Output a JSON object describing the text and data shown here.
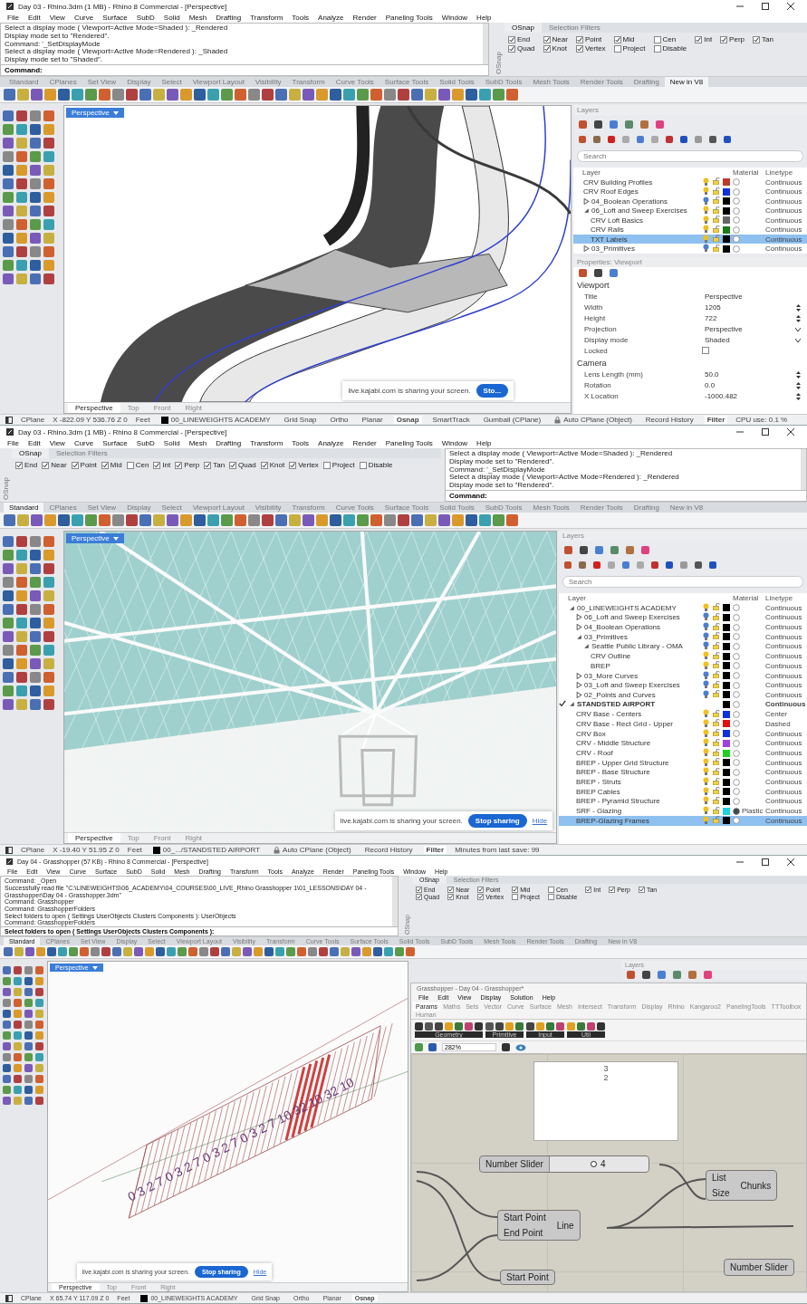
{
  "windows": [
    {
      "title": "Day 03 - Rhino.3dm (1 MB) - Rhino 8 Commercial - [Perspective]",
      "menu": [
        "File",
        "Edit",
        "View",
        "Curve",
        "Surface",
        "SubD",
        "Solid",
        "Mesh",
        "Drafting",
        "Transform",
        "Tools",
        "Analyze",
        "Render",
        "Paneling Tools",
        "Window",
        "Help"
      ],
      "command": {
        "lines": [
          "Select a display mode ( Viewport=Active  Mode=Shaded ): _Rendered",
          "Display mode set to \"Rendered\".",
          "Command: '_SetDisplayMode",
          "Select a display mode ( Viewport=Active  Mode=Rendered ): _Shaded",
          "Display mode set to \"Shaded\"."
        ],
        "prompt": "Command:"
      },
      "osnap": {
        "side_label": "OSnap",
        "tabs": [
          {
            "label": "OSnap",
            "selected": true
          },
          {
            "label": "Selection Filters",
            "selected": false
          }
        ],
        "options": [
          {
            "label": "End",
            "checked": true
          },
          {
            "label": "Near",
            "checked": true
          },
          {
            "label": "Point",
            "checked": true
          },
          {
            "label": "Mid",
            "checked": true
          },
          {
            "label": "Cen",
            "checked": false
          },
          {
            "label": "Int",
            "checked": true
          },
          {
            "label": "Perp",
            "checked": true
          },
          {
            "label": "Tan",
            "checked": true
          },
          {
            "label": "Quad",
            "checked": true
          },
          {
            "label": "Knot",
            "checked": true
          },
          {
            "label": "Vertex",
            "checked": true
          },
          {
            "label": "Project",
            "checked": false
          },
          {
            "label": "Disable",
            "checked": false
          }
        ]
      },
      "toolbar_tabs": [
        {
          "label": "Standard",
          "selected": false
        },
        {
          "label": "CPlanes",
          "selected": false
        },
        {
          "label": "Set View",
          "selected": false
        },
        {
          "label": "Display",
          "selected": false
        },
        {
          "label": "Select",
          "selected": false
        },
        {
          "label": "Viewport Layout",
          "selected": false
        },
        {
          "label": "Visibility",
          "selected": false
        },
        {
          "label": "Transform",
          "selected": false
        },
        {
          "label": "Curve Tools",
          "selected": false
        },
        {
          "label": "Surface Tools",
          "selected": false
        },
        {
          "label": "Solid Tools",
          "selected": false
        },
        {
          "label": "SubD Tools",
          "selected": false
        },
        {
          "label": "Mesh Tools",
          "selected": false
        },
        {
          "label": "Render Tools",
          "selected": false
        },
        {
          "label": "Drafting",
          "selected": false
        },
        {
          "label": "New in V8",
          "selected": true
        }
      ],
      "viewport": {
        "label": "Perspective",
        "tabs": [
          {
            "label": "Perspective",
            "selected": true
          },
          {
            "label": "Top",
            "selected": false
          },
          {
            "label": "Front",
            "selected": false
          },
          {
            "label": "Right",
            "selected": false
          }
        ]
      },
      "sharing": {
        "text": "live.kajabi.com is sharing your screen.",
        "button": "Sto..."
      },
      "panel": {
        "kind": "layers-properties",
        "layers": {
          "title": "Layers",
          "placeholder": "Search",
          "columns": [
            "Layer",
            "Material",
            "Linetype"
          ],
          "rows": [
            {
              "name": "CRV Building Profiles",
              "lit": true,
              "color": "#c0392b",
              "linetype": "Continuous",
              "selected": false
            },
            {
              "name": "CRV Roof Edges",
              "lit": true,
              "color": "#1030e0",
              "linetype": "Continuous",
              "selected": false
            },
            {
              "name": "04_Boolean Operations",
              "lit": false,
              "color": "#000000",
              "linetype": "Continuous",
              "selected": false,
              "expanded": false
            },
            {
              "name": "06_Loft and Sweep Exercises",
              "lit": true,
              "color": "#000000",
              "linetype": "Continuous",
              "selected": false,
              "expanded": true,
              "children": [
                {
                  "name": "CRV Loft Basics",
                  "lit": true,
                  "color": "#666666",
                  "linetype": "Continuous",
                  "selected": false
                },
                {
                  "name": "CRV Rails",
                  "lit": true,
                  "color": "#1a7a1a",
                  "linetype": "Continuous",
                  "selected": false
                },
                {
                  "name": "TXT Labels",
                  "lit": true,
                  "color": "#000000",
                  "linetype": "Continuous",
                  "selected": true
                }
              ]
            },
            {
              "name": "03_Primitives",
              "lit": false,
              "color": "#000000",
              "linetype": "Continuous",
              "selected": false,
              "expanded": false
            }
          ]
        },
        "properties": {
          "title": "Properties: Viewport",
          "sections": [
            {
              "title": "Viewport",
              "fields": [
                {
                  "label": "Title",
                  "kind": "text",
                  "value": "Perspective"
                },
                {
                  "label": "Width",
                  "kind": "spin",
                  "value": "1205"
                },
                {
                  "label": "Height",
                  "kind": "spin",
                  "value": "722"
                },
                {
                  "label": "Projection",
                  "kind": "select",
                  "value": "Perspective"
                },
                {
                  "label": "Display mode",
                  "kind": "select",
                  "value": "Shaded"
                },
                {
                  "label": "Locked",
                  "kind": "checkbox",
                  "checked": false
                }
              ]
            },
            {
              "title": "Camera",
              "fields": [
                {
                  "label": "Lens Length (mm)",
                  "kind": "spin",
                  "value": "50.0"
                },
                {
                  "label": "Rotation",
                  "kind": "spin",
                  "value": "0.0"
                },
                {
                  "label": "X Location",
                  "kind": "spin",
                  "value": "-1000.482"
                }
              ]
            }
          ]
        }
      },
      "status": [
        {
          "kind": "cplane",
          "text": "CPlane"
        },
        {
          "kind": "plain",
          "text": "X -822.09 Y 536.76 Z 0"
        },
        {
          "kind": "plain",
          "text": "Feet"
        },
        {
          "kind": "layer",
          "text": "00_LINEWEIGHTS ACADEMY",
          "color": "#000000"
        },
        {
          "kind": "toggle",
          "text": "Grid Snap",
          "on": false
        },
        {
          "kind": "toggle",
          "text": "Ortho",
          "on": false
        },
        {
          "kind": "toggle",
          "text": "Planar",
          "on": false
        },
        {
          "kind": "toggle",
          "text": "Osnap",
          "on": true
        },
        {
          "kind": "toggle",
          "text": "SmartTrack",
          "on": false
        },
        {
          "kind": "toggle",
          "text": "Gumball (CPlane)",
          "on": false
        },
        {
          "kind": "lock",
          "text": "Auto CPlane (Object)"
        },
        {
          "kind": "toggle",
          "text": "Record History",
          "on": false
        },
        {
          "kind": "toggle",
          "text": "Filter",
          "on": true
        },
        {
          "kind": "plain",
          "text": "CPU use: 0.1 %"
        }
      ]
    },
    {
      "title": "Day 03 - Rhino.3dm (1 MB) - Rhino 8 Commercial - [Perspective]",
      "menu": [
        "File",
        "Edit",
        "View",
        "Curve",
        "Surface",
        "SubD",
        "Solid",
        "Mesh",
        "Drafting",
        "Transform",
        "Tools",
        "Analyze",
        "Render",
        "Paneling Tools",
        "Window",
        "Help"
      ],
      "command": {
        "lines": [
          "Select a display mode ( Viewport=Active  Mode=Shaded ): _Rendered",
          "Display mode set to \"Rendered\".",
          "Command: '_SetDisplayMode",
          "Select a display mode ( Viewport=Active  Mode=Rendered ): _Rendered",
          "Display mode set to \"Rendered\"."
        ],
        "prompt": "Command:"
      },
      "osnap": {
        "side_label": "OSnap",
        "tabs": [
          {
            "label": "OSnap",
            "selected": true
          },
          {
            "label": "Selection Filters",
            "selected": false
          }
        ],
        "options": [
          {
            "label": "End",
            "checked": true
          },
          {
            "label": "Near",
            "checked": true
          },
          {
            "label": "Point",
            "checked": true
          },
          {
            "label": "Mid",
            "checked": true
          },
          {
            "label": "Cen",
            "checked": false
          },
          {
            "label": "Int",
            "checked": true
          },
          {
            "label": "Perp",
            "checked": true
          },
          {
            "label": "Tan",
            "checked": true
          },
          {
            "label": "Quad",
            "checked": true
          },
          {
            "label": "Knot",
            "checked": true
          },
          {
            "label": "Vertex",
            "checked": true
          },
          {
            "label": "Project",
            "checked": false
          },
          {
            "label": "Disable",
            "checked": false
          }
        ]
      },
      "toolbar_tabs": [
        {
          "label": "Standard",
          "selected": true
        },
        {
          "label": "CPlanes",
          "selected": false
        },
        {
          "label": "Set View",
          "selected": false
        },
        {
          "label": "Display",
          "selected": false
        },
        {
          "label": "Select",
          "selected": false
        },
        {
          "label": "Viewport Layout",
          "selected": false
        },
        {
          "label": "Visibility",
          "selected": false
        },
        {
          "label": "Transform",
          "selected": false
        },
        {
          "label": "Curve Tools",
          "selected": false
        },
        {
          "label": "Surface Tools",
          "selected": false
        },
        {
          "label": "Solid Tools",
          "selected": false
        },
        {
          "label": "SubD Tools",
          "selected": false
        },
        {
          "label": "Mesh Tools",
          "selected": false
        },
        {
          "label": "Render Tools",
          "selected": false
        },
        {
          "label": "Drafting",
          "selected": false
        },
        {
          "label": "New in V8",
          "selected": false
        }
      ],
      "viewport": {
        "label": "Perspective",
        "tabs": [
          {
            "label": "Perspective",
            "selected": true
          },
          {
            "label": "Top",
            "selected": false
          },
          {
            "label": "Front",
            "selected": false
          },
          {
            "label": "Right",
            "selected": false
          }
        ]
      },
      "sharing": {
        "text": "live.kajabi.com is sharing your screen.",
        "button": "Stop sharing",
        "hide": "Hide"
      },
      "panel": {
        "kind": "layers",
        "layers": {
          "title": "Layers",
          "placeholder": "Search",
          "columns": [
            "Layer",
            "Material",
            "Linetype"
          ],
          "rows": [
            {
              "name": "00_LINEWEIGHTS ACADEMY",
              "lit": true,
              "color": "#000000",
              "linetype": "Continuous",
              "selected": false,
              "current": false,
              "expanded": true,
              "children": [
                {
                  "name": "06_Loft and Sweep Exercises",
                  "lit": false,
                  "color": "#000000",
                  "linetype": "Continuous",
                  "selected": false,
                  "expanded": false
                },
                {
                  "name": "04_Boolean Operations",
                  "lit": false,
                  "color": "#000000",
                  "linetype": "Continuous",
                  "selected": false,
                  "expanded": false
                },
                {
                  "name": "03_Primitives",
                  "lit": false,
                  "color": "#000000",
                  "linetype": "Continuous",
                  "selected": false,
                  "expanded": true,
                  "children": [
                    {
                      "name": "Seattle Public Library - OMA",
                      "lit": false,
                      "color": "#000000",
                      "linetype": "Continuous",
                      "selected": false,
                      "expanded": true,
                      "children": [
                        {
                          "name": "CRV Outline",
                          "lit": true,
                          "color": "#000000",
                          "linetype": "Continuous",
                          "selected": false
                        },
                        {
                          "name": "BREP",
                          "lit": true,
                          "color": "#000000",
                          "linetype": "Continuous",
                          "selected": false
                        }
                      ]
                    }
                  ]
                },
                {
                  "name": "03_More Curves",
                  "lit": false,
                  "color": "#000000",
                  "linetype": "Continuous",
                  "selected": false,
                  "expanded": false
                },
                {
                  "name": "03_Loft and Sweep Exercises",
                  "lit": false,
                  "color": "#000000",
                  "linetype": "Continuous",
                  "selected": false,
                  "expanded": false
                },
                {
                  "name": "02_Points and Curves",
                  "lit": false,
                  "color": "#000000",
                  "linetype": "Continuous",
                  "selected": false,
                  "expanded": false
                }
              ]
            },
            {
              "name": "STANDSTED AIRPORT",
              "color": "#000000",
              "linetype": "Continuous",
              "selected": false,
              "current": true,
              "expanded": true,
              "children": [
                {
                  "name": "CRV Base - Centers",
                  "lit": true,
                  "color": "#1030e0",
                  "linetype": "Center",
                  "selected": false
                },
                {
                  "name": "CRV Base - Rect Grid - Upper",
                  "lit": true,
                  "color": "#e01010",
                  "linetype": "Dashed",
                  "selected": false
                },
                {
                  "name": "CRV Box",
                  "lit": true,
                  "color": "#1030e0",
                  "linetype": "Continuous",
                  "selected": false
                },
                {
                  "name": "CRV - Middle Structure",
                  "lit": true,
                  "color": "#a040e0",
                  "linetype": "Continuous",
                  "selected": false
                },
                {
                  "name": "CRV - Roof",
                  "lit": true,
                  "color": "#20d020",
                  "linetype": "Continuous",
                  "selected": false
                },
                {
                  "name": "BREP - Upper Grid Structure",
                  "lit": true,
                  "color": "#000000",
                  "linetype": "Continuous",
                  "selected": false
                },
                {
                  "name": "BREP - Base Structure",
                  "lit": true,
                  "color": "#000000",
                  "linetype": "Continuous",
                  "selected": false
                },
                {
                  "name": "BREP - Struts",
                  "lit": true,
                  "color": "#000000",
                  "linetype": "Continuous",
                  "selected": false
                },
                {
                  "name": "BREP Cables",
                  "lit": true,
                  "color": "#000000",
                  "linetype": "Continuous",
                  "selected": false
                },
                {
                  "name": "BREP - Pyramid Structure",
                  "lit": true,
                  "color": "#000000",
                  "linetype": "Continuous",
                  "selected": false
                },
                {
                  "name": "SRF - Glazing",
                  "lit": true,
                  "color": "#20d0e0",
                  "linetype": "Continuous",
                  "selected": false,
                  "material": "Plastic"
                },
                {
                  "name": "BREP-Glazing Frames",
                  "lit": true,
                  "color": "#000000",
                  "linetype": "Continuous",
                  "selected": true
                }
              ]
            }
          ]
        }
      },
      "status": [
        {
          "kind": "cplane",
          "text": "CPlane"
        },
        {
          "kind": "plain",
          "text": "X -19.40 Y 51.95 Z 0"
        },
        {
          "kind": "plain",
          "text": "Feet"
        },
        {
          "kind": "layer",
          "text": "00_.../STANDSTED AIRPORT",
          "color": "#000000"
        },
        {
          "kind": "lock",
          "text": "Auto CPlane (Object)"
        },
        {
          "kind": "toggle",
          "text": "Record History",
          "on": false
        },
        {
          "kind": "toggle",
          "text": "Filter",
          "on": true
        },
        {
          "kind": "plain",
          "text": "Minutes from last save: 99"
        }
      ]
    },
    {
      "title": "Day 04 - Grasshopper (57 KB) - Rhino 8 Commercial - [Perspective]",
      "menu": [
        "File",
        "Edit",
        "View",
        "Curve",
        "Surface",
        "SubD",
        "Solid",
        "Mesh",
        "Drafting",
        "Transform",
        "Tools",
        "Analyze",
        "Render",
        "Paneling Tools",
        "Window",
        "Help"
      ],
      "command": {
        "lines": [
          "Command: _Open",
          "Successfully read file \"C:\\LINEWEIGHTS\\06_ACADEMY\\04_COURSES\\00_LIVE_Rhino Grasshopper 1\\01_LESSONS\\DAY 04 - Grasshopper\\Day 04 - Grasshopper.3dm\"",
          "Command: Grasshopper",
          "Command: GrasshopperFolders",
          "Select folders to open ( Settings  UserObjects  Clusters  Components ): UserObjects",
          "Command: GrasshopperFolders"
        ],
        "prompt": "Select folders to open ( Settings  UserObjects  Clusters  Components ):"
      },
      "osnap": {
        "side_label": "OSnap",
        "tabs": [
          {
            "label": "OSnap",
            "selected": true
          },
          {
            "label": "Selection Filters",
            "selected": false
          }
        ],
        "options": [
          {
            "label": "End",
            "checked": true
          },
          {
            "label": "Near",
            "checked": true
          },
          {
            "label": "Point",
            "checked": true
          },
          {
            "label": "Mid",
            "checked": true
          },
          {
            "label": "Cen",
            "checked": false
          },
          {
            "label": "Int",
            "checked": true
          },
          {
            "label": "Perp",
            "checked": true
          },
          {
            "label": "Tan",
            "checked": true
          },
          {
            "label": "Quad",
            "checked": true
          },
          {
            "label": "Knot",
            "checked": true
          },
          {
            "label": "Vertex",
            "checked": true
          },
          {
            "label": "Project",
            "checked": false
          },
          {
            "label": "Disable",
            "checked": false
          }
        ]
      },
      "toolbar_tabs": [
        {
          "label": "Standard",
          "selected": true
        },
        {
          "label": "CPlanes",
          "selected": false
        },
        {
          "label": "Set View",
          "selected": false
        },
        {
          "label": "Display",
          "selected": false
        },
        {
          "label": "Select",
          "selected": false
        },
        {
          "label": "Viewport Layout",
          "selected": false
        },
        {
          "label": "Visibility",
          "selected": false
        },
        {
          "label": "Transform",
          "selected": false
        },
        {
          "label": "Curve Tools",
          "selected": false
        },
        {
          "label": "Surface Tools",
          "selected": false
        },
        {
          "label": "Solid Tools",
          "selected": false
        },
        {
          "label": "SubD Tools",
          "selected": false
        },
        {
          "label": "Mesh Tools",
          "selected": false
        },
        {
          "label": "Render Tools",
          "selected": false
        },
        {
          "label": "Drafting",
          "selected": false
        },
        {
          "label": "New in V8",
          "selected": false
        }
      ],
      "viewport": {
        "label": "Perspective",
        "point_labels": "0 3 2 7 0 3 2 7 0 3 2 7 0 3 2 7 10 32 10 32 10",
        "tabs": [
          {
            "label": "Perspective",
            "selected": true
          },
          {
            "label": "Top",
            "selected": false
          },
          {
            "label": "Front",
            "selected": false
          },
          {
            "label": "Right",
            "selected": false
          }
        ]
      },
      "sharing": {
        "text": "live.kajabi.com is sharing your screen.",
        "button": "Stop sharing",
        "hide": "Hide"
      },
      "panel": {
        "kind": "grasshopper",
        "layers_title": "Layers",
        "gh": {
          "title": "Grasshopper - Day 04 - Grasshopper*",
          "menu": [
            "File",
            "Edit",
            "View",
            "Display",
            "Solution",
            "Help"
          ],
          "tabs": [
            {
              "label": "Params",
              "selected": true
            },
            {
              "label": "Maths",
              "selected": false
            },
            {
              "label": "Sets",
              "selected": false
            },
            {
              "label": "Vector",
              "selected": false
            },
            {
              "label": "Curve",
              "selected": false
            },
            {
              "label": "Surface",
              "selected": false
            },
            {
              "label": "Mesh",
              "selected": false
            },
            {
              "label": "Intersect",
              "selected": false
            },
            {
              "label": "Transform",
              "selected": false
            },
            {
              "label": "Display",
              "selected": false
            },
            {
              "label": "Rhino",
              "selected": false
            },
            {
              "label": "Kangaroo2",
              "selected": false
            },
            {
              "label": "PanelingTools",
              "selected": false
            },
            {
              "label": "TTToolbox",
              "selected": false
            },
            {
              "label": "Human",
              "selected": false
            }
          ],
          "groups": [
            "Geometry",
            "Primitive",
            "Input",
            "Util"
          ],
          "zoom": "282%",
          "panel_values": [
            "3",
            "2"
          ],
          "components": [
            {
              "kind": "slider",
              "label": "Number Slider",
              "value": "4",
              "level": 0.45
            },
            {
              "kind": "component",
              "inputs": [
                "List",
                "Size"
              ],
              "output": "Chunks"
            },
            {
              "kind": "component",
              "inputs": [
                "Start Point",
                "End Point"
              ],
              "output": "Line"
            },
            {
              "kind": "slider-cut",
              "label": "Number Slider"
            },
            {
              "kind": "component-cut",
              "inputs": [
                "Start Point"
              ]
            }
          ]
        }
      },
      "status": [
        {
          "kind": "cplane",
          "text": "CPlane"
        },
        {
          "kind": "plain",
          "text": "X 65.74 Y 117.09 Z 0"
        },
        {
          "kind": "plain",
          "text": "Feet"
        },
        {
          "kind": "layer",
          "text": "00_LINEWEIGHTS ACADEMY",
          "color": "#000000"
        },
        {
          "kind": "toggle",
          "text": "Grid Snap",
          "on": false
        },
        {
          "kind": "toggle",
          "text": "Ortho",
          "on": false
        },
        {
          "kind": "toggle",
          "text": "Planar",
          "on": false
        },
        {
          "kind": "toggle",
          "text": "Osnap",
          "on": true
        }
      ]
    }
  ]
}
